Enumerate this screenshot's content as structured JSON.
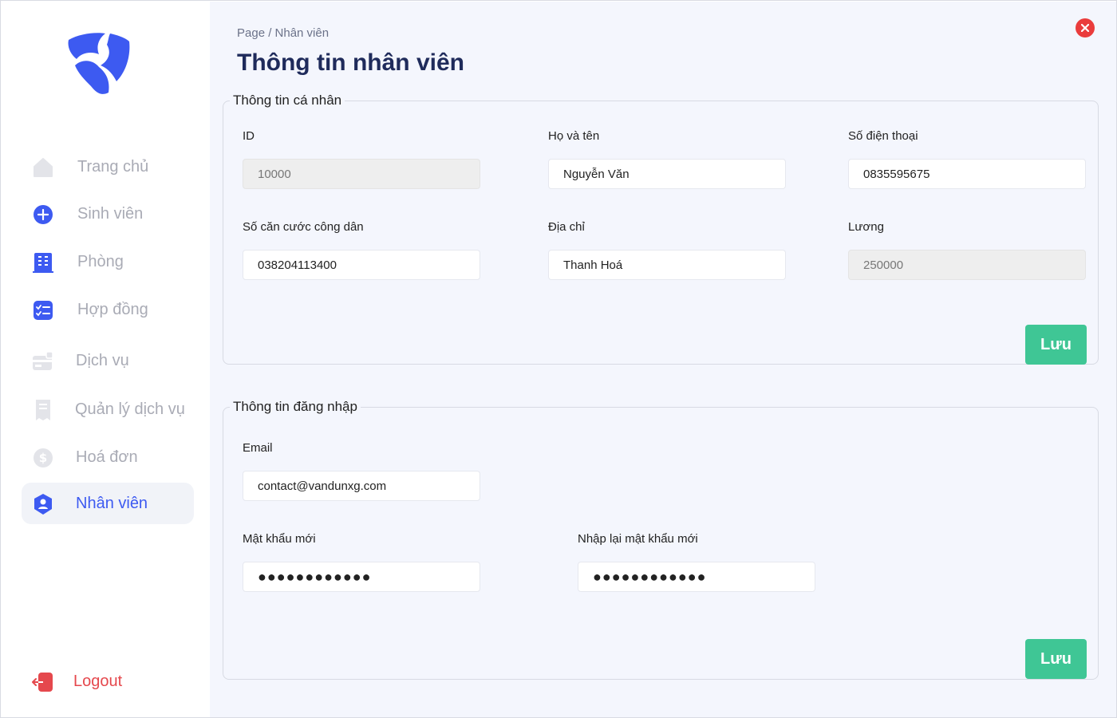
{
  "sidebar": {
    "items": [
      {
        "label": "Trang chủ",
        "icon": "home-icon"
      },
      {
        "label": "Sinh viên",
        "icon": "add-circle-icon"
      },
      {
        "label": "Phòng",
        "icon": "building-icon"
      },
      {
        "label": "Hợp đồng",
        "icon": "checklist-icon"
      },
      {
        "label": "Dịch vụ",
        "icon": "card-icon"
      },
      {
        "label": "Quản lý dịch vụ",
        "icon": "receipt-icon"
      },
      {
        "label": "Hoá đơn",
        "icon": "dollar-icon"
      },
      {
        "label": "Nhân viên",
        "icon": "user-shield-icon"
      }
    ],
    "active": "Nhân viên",
    "logout": "Logout"
  },
  "header": {
    "breadcrumb": "Page / Nhân viên",
    "title": "Thông tin nhân viên"
  },
  "personal": {
    "legend": "Thông tin cá nhân",
    "id_label": "ID",
    "id_value": "10000",
    "name_label": "Họ và tên",
    "name_value": "Nguyễn Văn",
    "phone_label": "Số điện thoại",
    "phone_value": "0835595675",
    "cccd_label": "Số căn cước công dân",
    "cccd_value": "038204113400",
    "address_label": "Địa chỉ",
    "address_value": "Thanh Hoá",
    "salary_label": "Lương",
    "salary_value": "250000",
    "save_label": "Lưu"
  },
  "login": {
    "legend": "Thông tin đăng nhập",
    "email_label": "Email",
    "email_value": "contact@vandunxg.com",
    "new_password_label": "Mật khẩu mới",
    "new_password_value": "●●●●●●●●●●●●",
    "confirm_password_label": "Nhập lại mật khẩu mới",
    "confirm_password_value": "●●●●●●●●●●●●",
    "save_label": "Lưu"
  },
  "colors": {
    "accent": "#3d5af1",
    "success": "#3fc695",
    "danger": "#e5484d",
    "title": "#1f2b5b"
  }
}
